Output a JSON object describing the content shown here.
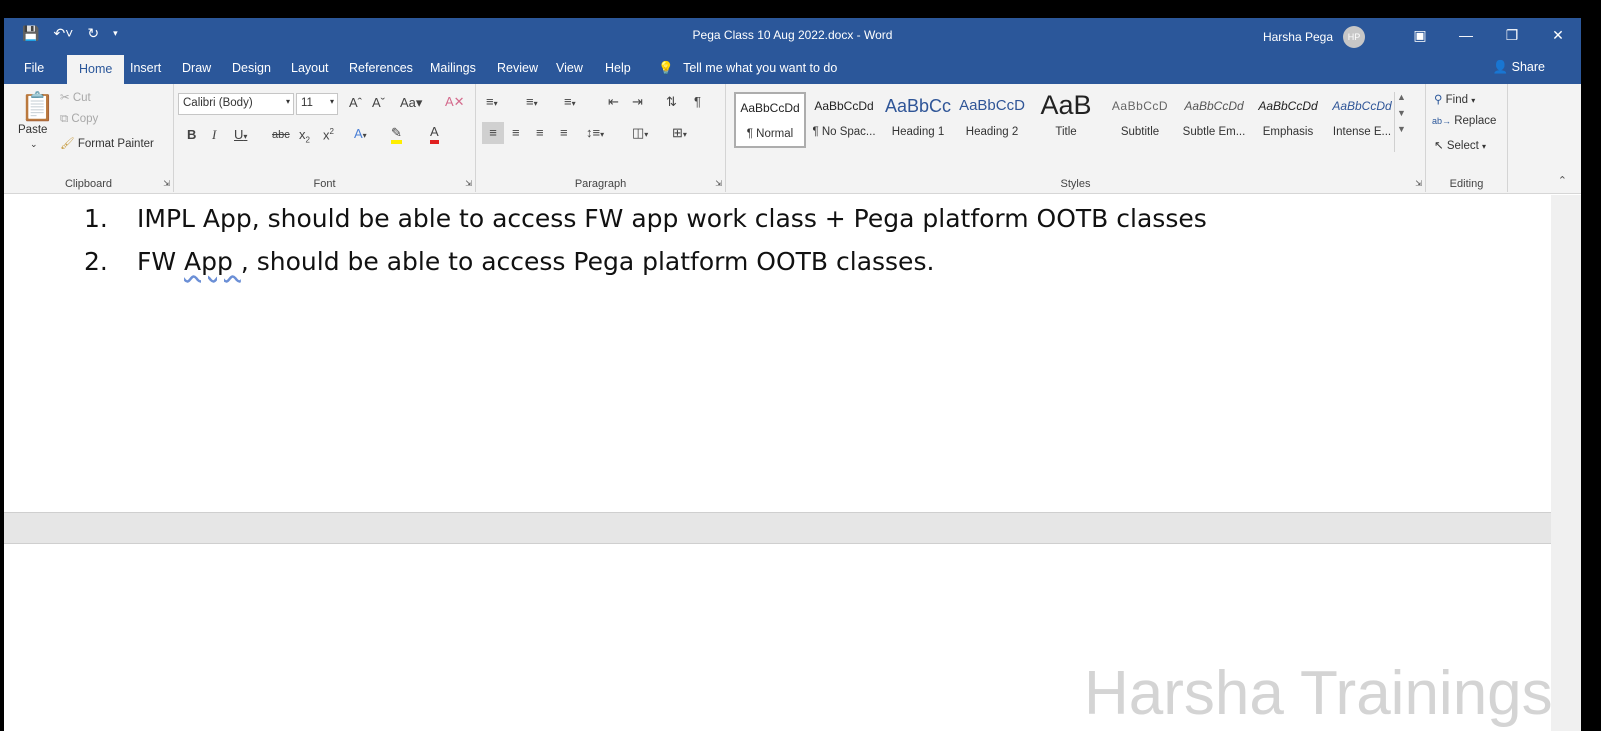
{
  "window": {
    "title": "Pega Class 10 Aug 2022.docx  -  Word",
    "user_name": "Harsha Pega",
    "user_initials": "HP"
  },
  "tabs": [
    "File",
    "Home",
    "Insert",
    "Draw",
    "Design",
    "Layout",
    "References",
    "Mailings",
    "Review",
    "View",
    "Help"
  ],
  "tell_me": "Tell me what you want to do",
  "share_label": "Share",
  "clipboard": {
    "paste": "Paste",
    "cut": "Cut",
    "copy": "Copy",
    "format_painter": "Format Painter",
    "label": "Clipboard"
  },
  "font": {
    "name": "Calibri (Body)",
    "size": "11",
    "label": "Font"
  },
  "paragraph": {
    "label": "Paragraph"
  },
  "styles": {
    "label": "Styles",
    "items": [
      {
        "preview": "AaBbCcDd",
        "name": "¶ Normal"
      },
      {
        "preview": "AaBbCcDd",
        "name": "¶ No Spac..."
      },
      {
        "preview": "AaBbCc",
        "name": "Heading 1"
      },
      {
        "preview": "AaBbCcD",
        "name": "Heading 2"
      },
      {
        "preview": "AaB",
        "name": "Title"
      },
      {
        "preview": "AaBbCcD",
        "name": "Subtitle"
      },
      {
        "preview": "AaBbCcDd",
        "name": "Subtle Em..."
      },
      {
        "preview": "AaBbCcDd",
        "name": "Emphasis"
      },
      {
        "preview": "AaBbCcDd",
        "name": "Intense E..."
      }
    ]
  },
  "editing": {
    "find": "Find",
    "replace": "Replace",
    "select": "Select",
    "label": "Editing"
  },
  "document": {
    "lines": [
      {
        "num": "1.",
        "text": "IMPL App, should be able to access FW app work class + Pega platform OOTB classes"
      },
      {
        "num": "2.",
        "pre": "FW ",
        "flagged": "App ",
        "post": ", should be able to access Pega platform OOTB classes."
      }
    ]
  },
  "watermark": "Harsha Trainings"
}
